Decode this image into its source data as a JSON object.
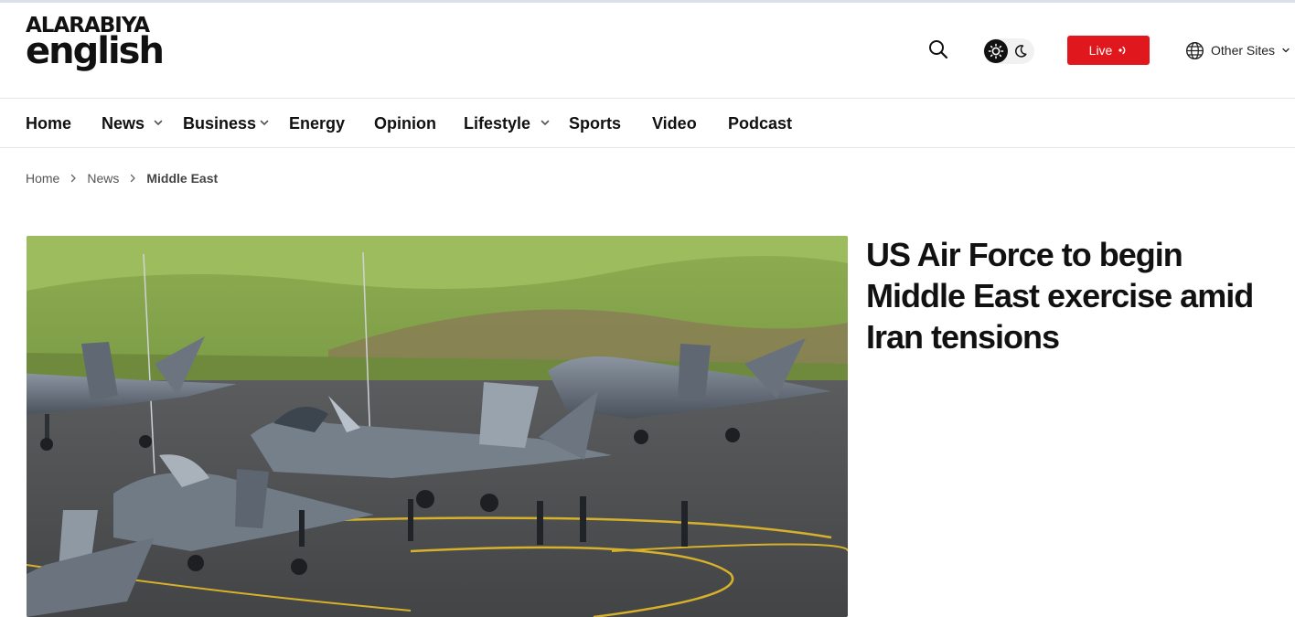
{
  "header": {
    "logo_top": "ALARABIYA",
    "logo_bottom": "english",
    "live_label": "Live",
    "other_sites_label": "Other Sites",
    "icons": [
      "search-icon",
      "sun-icon",
      "moon-icon",
      "live-dot-icon",
      "globe-icon",
      "chevron-down-icon"
    ]
  },
  "nav": {
    "items": [
      {
        "label": "Home",
        "has_dropdown": false
      },
      {
        "label": "News",
        "has_dropdown": true
      },
      {
        "label": "Business",
        "has_dropdown": true
      },
      {
        "label": "Energy",
        "has_dropdown": false
      },
      {
        "label": "Opinion",
        "has_dropdown": false
      },
      {
        "label": "Lifestyle",
        "has_dropdown": true
      },
      {
        "label": "Sports",
        "has_dropdown": false
      },
      {
        "label": "Video",
        "has_dropdown": false
      },
      {
        "label": "Podcast",
        "has_dropdown": false
      }
    ]
  },
  "breadcrumb": {
    "items": [
      "Home",
      "News",
      "Middle East"
    ]
  },
  "article": {
    "headline": "US Air Force to begin Middle East exercise amid Iran tensions"
  },
  "colors": {
    "accent_red": "#e0171d",
    "text": "#111111",
    "divider": "#e6e6e6"
  }
}
